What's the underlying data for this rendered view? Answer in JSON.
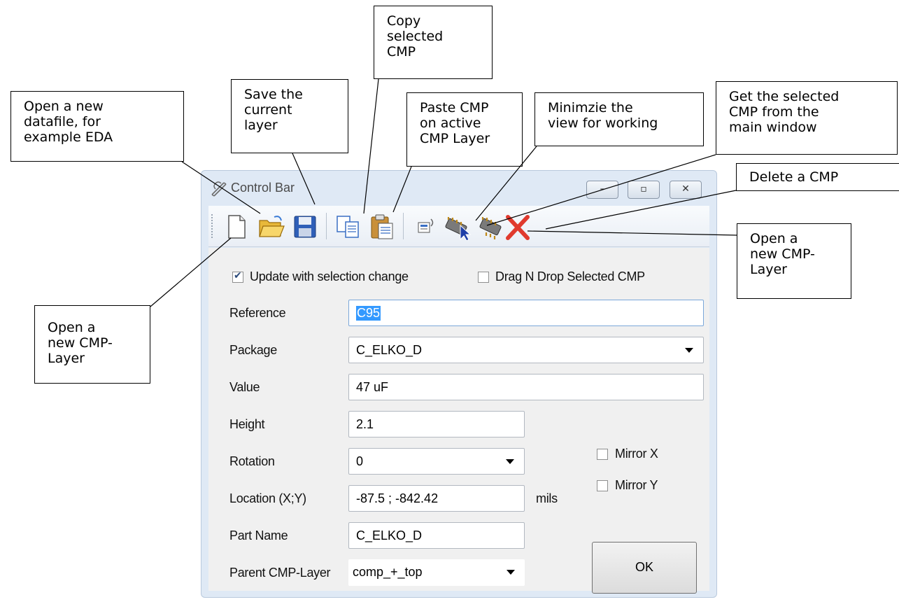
{
  "callouts": {
    "open_datafile": "Open a new\ndatafile, for\nexample EDA",
    "save_layer": "Save the\ncurrent\nlayer",
    "copy_cmp": "Copy\nselected\nCMP",
    "paste_cmp": "Paste CMP\non active\nCMP Layer",
    "minimize_view": "Minimzie the\nview for working",
    "get_selected": "Get the selected\nCMP from the\nmain window",
    "delete_cmp": "Delete a CMP",
    "open_cmp_layer_right": "Open a\nnew CMP-\nLayer",
    "open_cmp_layer_left": "Open a\nnew CMP-\nLayer"
  },
  "window": {
    "title": "Control Bar",
    "buttons": {
      "minimize": "–",
      "maximize": "▫",
      "close": "✕"
    }
  },
  "toolbar": {
    "icons": [
      "new-file-icon",
      "open-folder-icon",
      "save-icon",
      "copy-icon",
      "paste-icon",
      "minimize-view-icon",
      "get-selected-cmp-icon",
      "new-cmp-layer-icon",
      "delete-icon"
    ]
  },
  "form": {
    "update_with_selection": {
      "label": "Update with selection change",
      "checked": true
    },
    "drag_n_drop": {
      "label": "Drag N Drop Selected CMP",
      "checked": false
    },
    "reference": {
      "label": "Reference",
      "value": "C95"
    },
    "package": {
      "label": "Package",
      "value": "C_ELKO_D"
    },
    "value": {
      "label": "Value",
      "value": "47 uF"
    },
    "height": {
      "label": "Height",
      "value": "2.1"
    },
    "rotation": {
      "label": "Rotation",
      "value": "0"
    },
    "location": {
      "label": "Location (X;Y)",
      "value": "-87.5 ; -842.42",
      "unit": "mils"
    },
    "part_name": {
      "label": "Part Name",
      "value": "C_ELKO_D"
    },
    "parent_layer": {
      "label": "Parent CMP-Layer",
      "value": "comp_+_top"
    },
    "mirror_x": {
      "label": "Mirror X",
      "checked": false
    },
    "mirror_y": {
      "label": "Mirror Y",
      "checked": false
    },
    "ok": "OK"
  },
  "colors": {
    "selection": "#3399ff",
    "window_frame": "#dfe9f5",
    "client_bg": "#f0f0f0"
  }
}
